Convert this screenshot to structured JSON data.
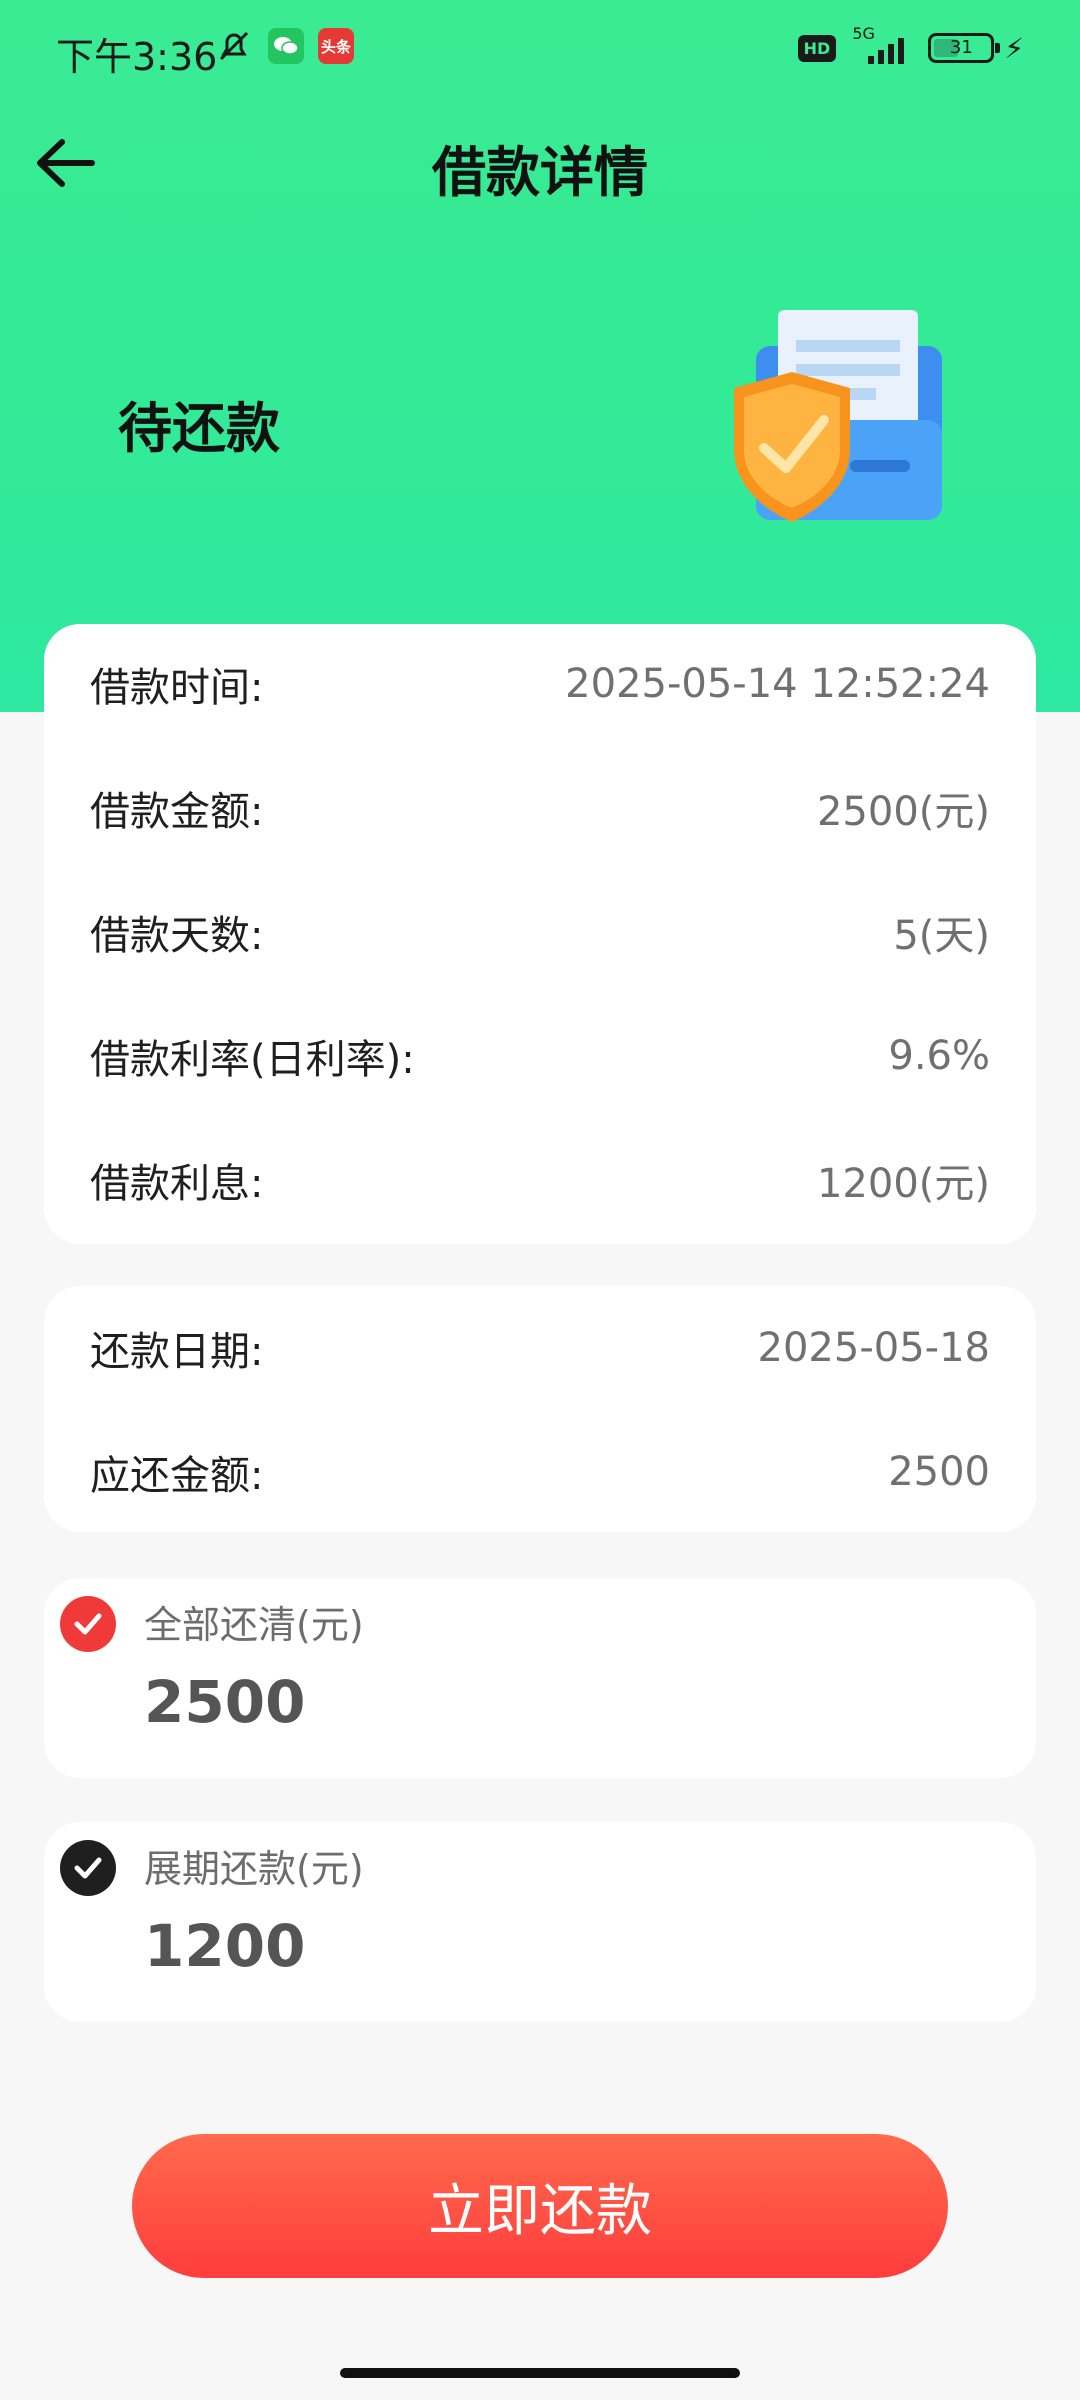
{
  "status_bar": {
    "time": "下午3:36",
    "icons": [
      "mute-icon",
      "wechat-icon",
      "toutiao-icon"
    ],
    "toutiao_text": "头条",
    "hd": "HD",
    "network": "5G",
    "battery": "31"
  },
  "header": {
    "title": "借款详情"
  },
  "hero": {
    "status": "待还款"
  },
  "loan_details": [
    {
      "label": "借款时间:",
      "value": "2025-05-14 12:52:24"
    },
    {
      "label": "借款金额:",
      "value": "2500(元)"
    },
    {
      "label": "借款天数:",
      "value": "5(天)"
    },
    {
      "label": "借款利率(日利率):",
      "value": "9.6%"
    },
    {
      "label": "借款利息:",
      "value": "1200(元)"
    }
  ],
  "repay_details": [
    {
      "label": "还款日期:",
      "value": "2025-05-18"
    },
    {
      "label": "应还金额:",
      "value": "2500"
    }
  ],
  "options": [
    {
      "label": "全部还清(元)",
      "amount": "2500",
      "selected": true,
      "color": "#f03a3a"
    },
    {
      "label": "展期还款(元)",
      "amount": "1200",
      "selected": false,
      "color": "#1f1f1f"
    }
  ],
  "pay_button": {
    "label": "立即还款"
  },
  "colors": {
    "hero": "#3aeb93",
    "button": "#ff4a42",
    "accent_red": "#f03a3a"
  }
}
